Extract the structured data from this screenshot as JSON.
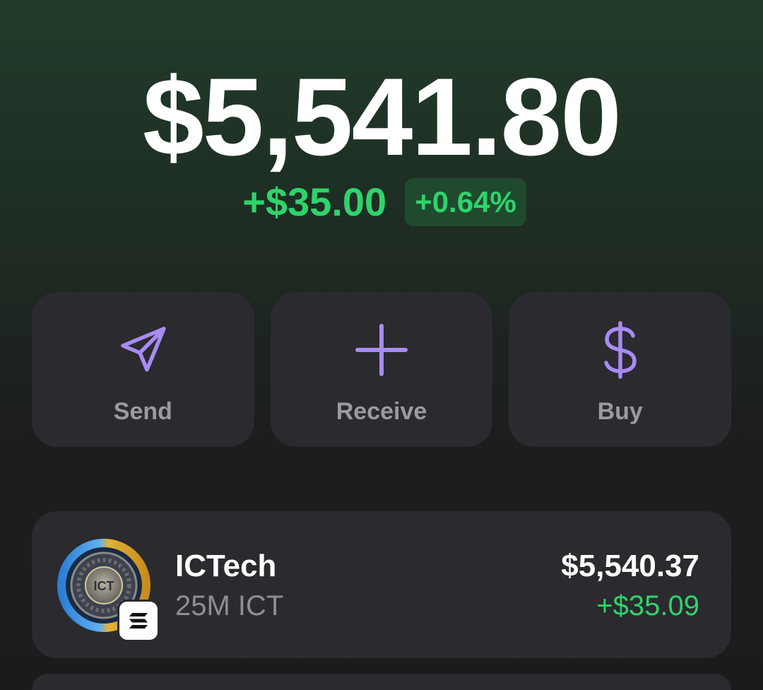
{
  "portfolio": {
    "balance": "$5,541.80",
    "change_amount": "+$35.00",
    "change_percent": "+0.64%"
  },
  "actions": [
    {
      "label": "Send",
      "icon": "send-icon"
    },
    {
      "label": "Receive",
      "icon": "plus-icon"
    },
    {
      "label": "Buy",
      "icon": "dollar-icon"
    }
  ],
  "tokens": [
    {
      "name": "ICTech",
      "amount": "25M ICT",
      "value": "$5,540.37",
      "change": "+$35.09",
      "logo_text": "ICT",
      "chain_icon": "solana-icon"
    }
  ],
  "colors": {
    "positive": "#2fd36b",
    "accent": "#a88bf2",
    "card": "#2a2a2f"
  }
}
